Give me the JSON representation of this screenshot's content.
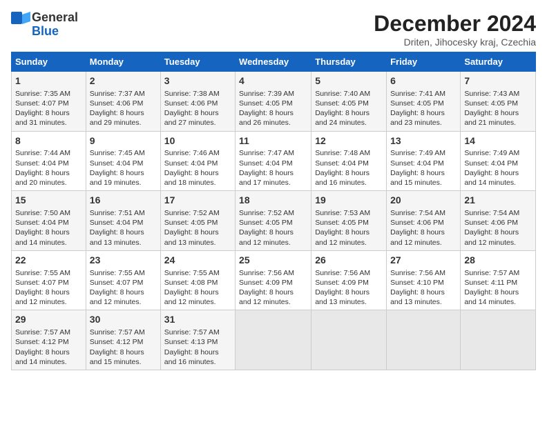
{
  "logo": {
    "line1": "General",
    "line2": "Blue"
  },
  "title": "December 2024",
  "subtitle": "Driten, Jihocesky kraj, Czechia",
  "days_of_week": [
    "Sunday",
    "Monday",
    "Tuesday",
    "Wednesday",
    "Thursday",
    "Friday",
    "Saturday"
  ],
  "weeks": [
    [
      {
        "day": 1,
        "info": "Sunrise: 7:35 AM\nSunset: 4:07 PM\nDaylight: 8 hours\nand 31 minutes."
      },
      {
        "day": 2,
        "info": "Sunrise: 7:37 AM\nSunset: 4:06 PM\nDaylight: 8 hours\nand 29 minutes."
      },
      {
        "day": 3,
        "info": "Sunrise: 7:38 AM\nSunset: 4:06 PM\nDaylight: 8 hours\nand 27 minutes."
      },
      {
        "day": 4,
        "info": "Sunrise: 7:39 AM\nSunset: 4:05 PM\nDaylight: 8 hours\nand 26 minutes."
      },
      {
        "day": 5,
        "info": "Sunrise: 7:40 AM\nSunset: 4:05 PM\nDaylight: 8 hours\nand 24 minutes."
      },
      {
        "day": 6,
        "info": "Sunrise: 7:41 AM\nSunset: 4:05 PM\nDaylight: 8 hours\nand 23 minutes."
      },
      {
        "day": 7,
        "info": "Sunrise: 7:43 AM\nSunset: 4:05 PM\nDaylight: 8 hours\nand 21 minutes."
      }
    ],
    [
      {
        "day": 8,
        "info": "Sunrise: 7:44 AM\nSunset: 4:04 PM\nDaylight: 8 hours\nand 20 minutes."
      },
      {
        "day": 9,
        "info": "Sunrise: 7:45 AM\nSunset: 4:04 PM\nDaylight: 8 hours\nand 19 minutes."
      },
      {
        "day": 10,
        "info": "Sunrise: 7:46 AM\nSunset: 4:04 PM\nDaylight: 8 hours\nand 18 minutes."
      },
      {
        "day": 11,
        "info": "Sunrise: 7:47 AM\nSunset: 4:04 PM\nDaylight: 8 hours\nand 17 minutes."
      },
      {
        "day": 12,
        "info": "Sunrise: 7:48 AM\nSunset: 4:04 PM\nDaylight: 8 hours\nand 16 minutes."
      },
      {
        "day": 13,
        "info": "Sunrise: 7:49 AM\nSunset: 4:04 PM\nDaylight: 8 hours\nand 15 minutes."
      },
      {
        "day": 14,
        "info": "Sunrise: 7:49 AM\nSunset: 4:04 PM\nDaylight: 8 hours\nand 14 minutes."
      }
    ],
    [
      {
        "day": 15,
        "info": "Sunrise: 7:50 AM\nSunset: 4:04 PM\nDaylight: 8 hours\nand 14 minutes."
      },
      {
        "day": 16,
        "info": "Sunrise: 7:51 AM\nSunset: 4:04 PM\nDaylight: 8 hours\nand 13 minutes."
      },
      {
        "day": 17,
        "info": "Sunrise: 7:52 AM\nSunset: 4:05 PM\nDaylight: 8 hours\nand 13 minutes."
      },
      {
        "day": 18,
        "info": "Sunrise: 7:52 AM\nSunset: 4:05 PM\nDaylight: 8 hours\nand 12 minutes."
      },
      {
        "day": 19,
        "info": "Sunrise: 7:53 AM\nSunset: 4:05 PM\nDaylight: 8 hours\nand 12 minutes."
      },
      {
        "day": 20,
        "info": "Sunrise: 7:54 AM\nSunset: 4:06 PM\nDaylight: 8 hours\nand 12 minutes."
      },
      {
        "day": 21,
        "info": "Sunrise: 7:54 AM\nSunset: 4:06 PM\nDaylight: 8 hours\nand 12 minutes."
      }
    ],
    [
      {
        "day": 22,
        "info": "Sunrise: 7:55 AM\nSunset: 4:07 PM\nDaylight: 8 hours\nand 12 minutes."
      },
      {
        "day": 23,
        "info": "Sunrise: 7:55 AM\nSunset: 4:07 PM\nDaylight: 8 hours\nand 12 minutes."
      },
      {
        "day": 24,
        "info": "Sunrise: 7:55 AM\nSunset: 4:08 PM\nDaylight: 8 hours\nand 12 minutes."
      },
      {
        "day": 25,
        "info": "Sunrise: 7:56 AM\nSunset: 4:09 PM\nDaylight: 8 hours\nand 12 minutes."
      },
      {
        "day": 26,
        "info": "Sunrise: 7:56 AM\nSunset: 4:09 PM\nDaylight: 8 hours\nand 13 minutes."
      },
      {
        "day": 27,
        "info": "Sunrise: 7:56 AM\nSunset: 4:10 PM\nDaylight: 8 hours\nand 13 minutes."
      },
      {
        "day": 28,
        "info": "Sunrise: 7:57 AM\nSunset: 4:11 PM\nDaylight: 8 hours\nand 14 minutes."
      }
    ],
    [
      {
        "day": 29,
        "info": "Sunrise: 7:57 AM\nSunset: 4:12 PM\nDaylight: 8 hours\nand 14 minutes."
      },
      {
        "day": 30,
        "info": "Sunrise: 7:57 AM\nSunset: 4:12 PM\nDaylight: 8 hours\nand 15 minutes."
      },
      {
        "day": 31,
        "info": "Sunrise: 7:57 AM\nSunset: 4:13 PM\nDaylight: 8 hours\nand 16 minutes."
      },
      null,
      null,
      null,
      null
    ]
  ]
}
